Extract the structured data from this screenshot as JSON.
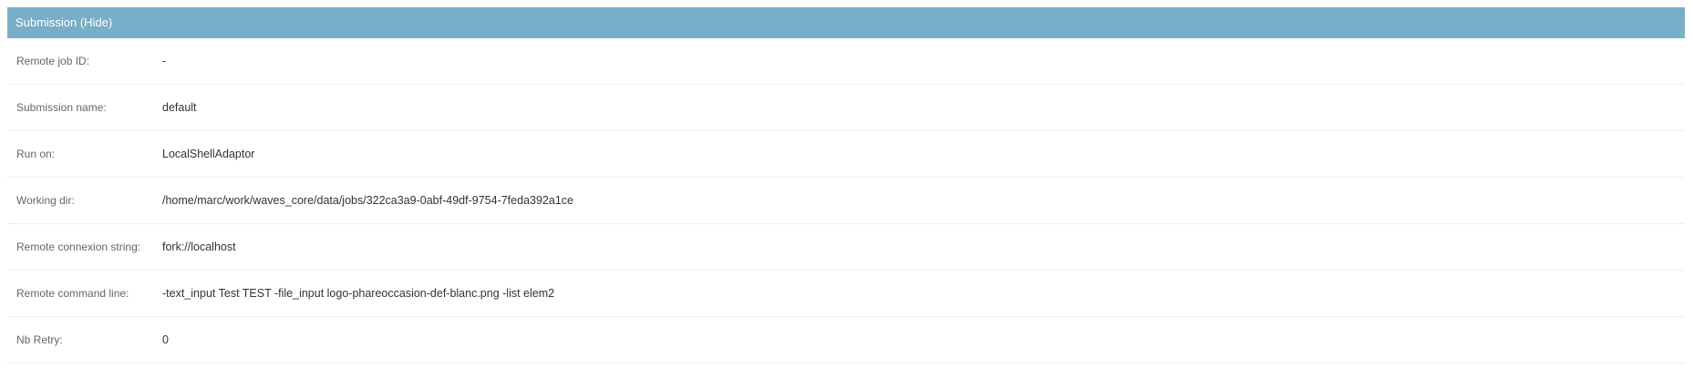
{
  "fieldset": {
    "title": "Submission",
    "toggle_label": "Hide"
  },
  "rows": [
    {
      "label": "Remote job ID:",
      "value": "-"
    },
    {
      "label": "Submission name:",
      "value": "default"
    },
    {
      "label": "Run on:",
      "value": "LocalShellAdaptor"
    },
    {
      "label": "Working dir:",
      "value": "/home/marc/work/waves_core/data/jobs/322ca3a9-0abf-49df-9754-7feda392a1ce"
    },
    {
      "label": "Remote connexion string:",
      "value": "fork://localhost"
    },
    {
      "label": "Remote command line:",
      "value": "-text_input Test TEST -file_input logo-phareoccasion-def-blanc.png -list elem2"
    },
    {
      "label": "Nb Retry:",
      "value": "0"
    }
  ]
}
